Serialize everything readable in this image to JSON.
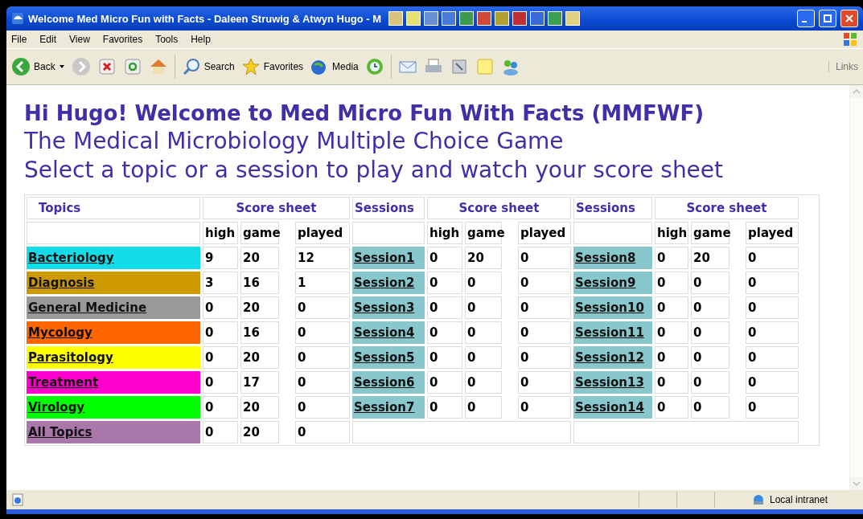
{
  "window": {
    "title": "Welcome Med Micro Fun with Facts - Daleen Struwig & Atwyn Hugo - M"
  },
  "menu": [
    "File",
    "Edit",
    "View",
    "Favorites",
    "Tools",
    "Help"
  ],
  "toolbar": {
    "back": "Back",
    "search": "Search",
    "favorites": "Favorites",
    "media": "Media",
    "links": "Links"
  },
  "headings": [
    "Hi Hugo! Welcome to Med Micro Fun With Facts (MMFWF)",
    "The Medical Microbiology Multiple Choice Game",
    "Select a topic or a session to play and watch your score sheet"
  ],
  "table": {
    "header_row": [
      "Topics",
      "Score sheet",
      "Sessions",
      "Score sheet",
      "Sessions",
      "Score sheet"
    ],
    "subheader_groups": [
      [
        "high",
        "game",
        "played"
      ],
      [
        "high",
        "game",
        "played"
      ],
      [
        "high",
        "game",
        "played"
      ]
    ],
    "topics": [
      {
        "name": "Bacteriology",
        "color": "#11dde8",
        "high": "9",
        "game": "20",
        "played": "12"
      },
      {
        "name": "Diagnosis",
        "color": "#cc9900",
        "high": "3",
        "game": "16",
        "played": "1"
      },
      {
        "name": "General Medicine",
        "color": "#999999",
        "high": "0",
        "game": "20",
        "played": "0"
      },
      {
        "name": "Mycology",
        "color": "#ff6600",
        "high": "0",
        "game": "16",
        "played": "0"
      },
      {
        "name": "Parasitology",
        "color": "#ffff00",
        "high": "0",
        "game": "20",
        "played": "0"
      },
      {
        "name": "Treatment",
        "color": "#ff00cc",
        "high": "0",
        "game": "17",
        "played": "0"
      },
      {
        "name": "Virology",
        "color": "#00ff00",
        "high": "0",
        "game": "20",
        "played": "0"
      },
      {
        "name": "All Topics",
        "color": "#aa77aa",
        "high": "0",
        "game": "20",
        "played": "0"
      }
    ],
    "session_groups": [
      [
        {
          "name": "Session1",
          "high": "0",
          "game": "20",
          "played": "0"
        },
        {
          "name": "Session2",
          "high": "0",
          "game": "0",
          "played": "0"
        },
        {
          "name": "Session3",
          "high": "0",
          "game": "0",
          "played": "0"
        },
        {
          "name": "Session4",
          "high": "0",
          "game": "0",
          "played": "0"
        },
        {
          "name": "Session5",
          "high": "0",
          "game": "0",
          "played": "0"
        },
        {
          "name": "Session6",
          "high": "0",
          "game": "0",
          "played": "0"
        },
        {
          "name": "Session7",
          "high": "0",
          "game": "0",
          "played": "0"
        }
      ],
      [
        {
          "name": "Session8",
          "high": "0",
          "game": "20",
          "played": "0"
        },
        {
          "name": "Session9",
          "high": "0",
          "game": "0",
          "played": "0"
        },
        {
          "name": "Session10",
          "high": "0",
          "game": "0",
          "played": "0"
        },
        {
          "name": "Session11",
          "high": "0",
          "game": "0",
          "played": "0"
        },
        {
          "name": "Session12",
          "high": "0",
          "game": "0",
          "played": "0"
        },
        {
          "name": "Session13",
          "high": "0",
          "game": "0",
          "played": "0"
        },
        {
          "name": "Session14",
          "high": "0",
          "game": "0",
          "played": "0"
        }
      ]
    ]
  },
  "status_bar": {
    "zone": "Local intranet"
  }
}
